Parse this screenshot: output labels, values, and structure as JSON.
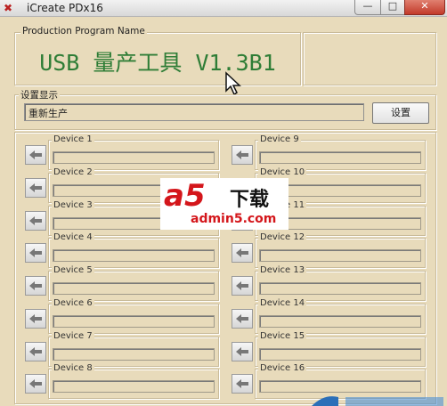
{
  "window": {
    "title": "iCreate PDx16",
    "controls": {
      "minimize": "—",
      "maximize": "□",
      "close": "✕"
    }
  },
  "product_group": {
    "label": "Production Program Name",
    "title": "USB 量产工具 V1.3B1"
  },
  "settings_group": {
    "label": "设置显示",
    "value": "重新生产",
    "button": "设置"
  },
  "devices_left": [
    "Device 1",
    "Device 2",
    "Device 3",
    "Device 4",
    "Device 5",
    "Device 6",
    "Device 7",
    "Device 8"
  ],
  "devices_right": [
    "Device 9",
    "Device 10",
    "Device 11",
    "Device 12",
    "Device 13",
    "Device 14",
    "Device 15",
    "Device 16"
  ],
  "watermark": {
    "brand": "a5",
    "suffix": "下载",
    "site": "admin5.com"
  },
  "icons": {
    "app": "app-logo-icon",
    "device_arrow": "arrow-left-icon",
    "cursor": "mouse-pointer-icon"
  }
}
